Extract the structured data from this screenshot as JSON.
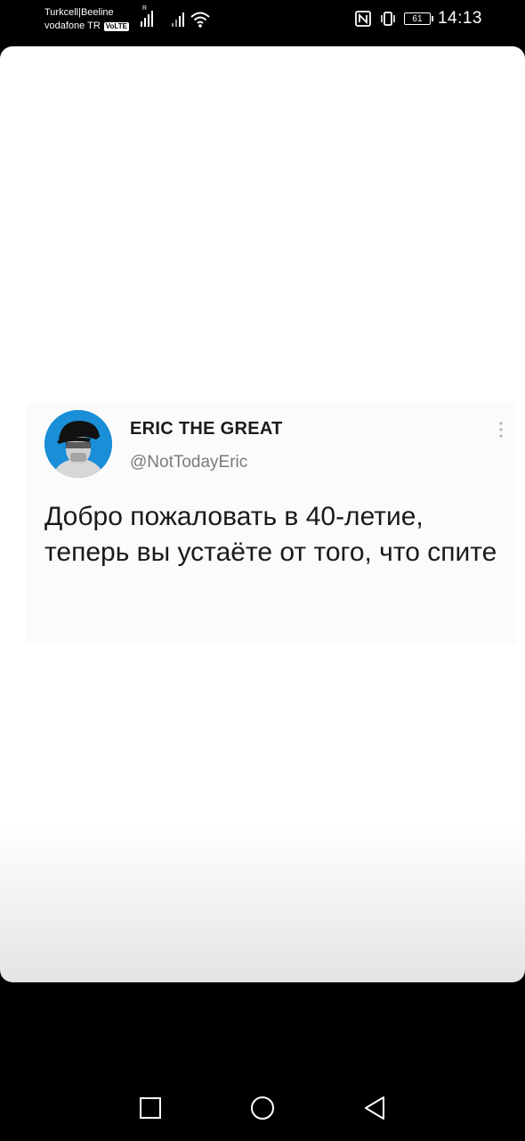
{
  "status_bar": {
    "carrier1": "Turkcell|Beeline",
    "carrier2": "vodafone TR",
    "volte_label": "VoLTE",
    "signal1_label": "R",
    "battery_level": "61",
    "time": "14:13"
  },
  "tweet": {
    "author_name": "ERIC THE GREAT",
    "handle": "@NotTodayEric",
    "text": "Добро пожаловать в 40-летие, теперь вы устаёте от того, что спите"
  },
  "colors": {
    "avatar_bg": "#1a8fd8",
    "text": "#1a1a1a",
    "handle": "#7b7b7b"
  },
  "icons": {
    "nfc": "nfc-icon",
    "vibrate": "vibrate-icon",
    "wifi": "wifi-icon",
    "more": "more-vertical-icon",
    "recent": "square-icon",
    "home": "circle-icon",
    "back": "triangle-back-icon"
  }
}
